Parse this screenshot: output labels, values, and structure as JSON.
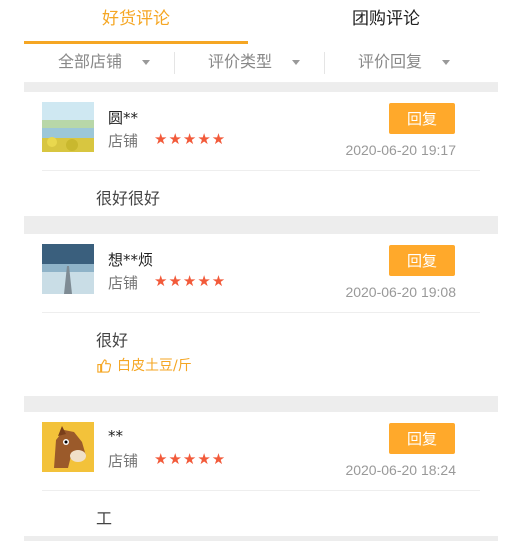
{
  "tabs": [
    {
      "label": "好货评论",
      "active": true
    },
    {
      "label": "团购评论",
      "active": false
    }
  ],
  "filters": [
    {
      "label": "全部店铺"
    },
    {
      "label": "评价类型"
    },
    {
      "label": "评价回复"
    }
  ],
  "reviews": [
    {
      "user": "圆**",
      "store_label": "店铺",
      "stars": "★★★★★",
      "reply_label": "回复",
      "time": "2020-06-20 19:17",
      "content": "很好很好",
      "product": ""
    },
    {
      "user": "想**烦",
      "store_label": "店铺",
      "stars": "★★★★★",
      "reply_label": "回复",
      "time": "2020-06-20 19:08",
      "content": "很好",
      "product": "白皮土豆/斤"
    },
    {
      "user": "**",
      "store_label": "店铺",
      "stars": "★★★★★",
      "reply_label": "回复",
      "time": "2020-06-20 18:24",
      "content": "工",
      "product": ""
    }
  ],
  "colors": {
    "accent": "#f5a623",
    "reply_button": "#ffa92b",
    "star": "#f25a3a"
  }
}
